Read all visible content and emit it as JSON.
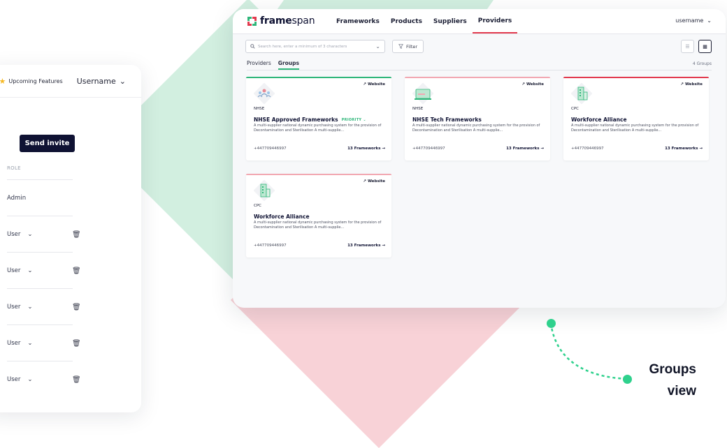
{
  "back_panel": {
    "upcoming_label": "Upcoming Features",
    "username": "Username",
    "invite_button": "Send invite",
    "role_header": "ROLE",
    "rows": [
      {
        "role": "Admin",
        "has_select": false
      },
      {
        "role": "User",
        "has_select": true
      },
      {
        "role": "User",
        "has_select": true
      },
      {
        "role": "User",
        "has_select": true
      },
      {
        "role": "User",
        "has_select": true
      },
      {
        "role": "User",
        "has_select": true
      }
    ]
  },
  "nav": {
    "logo_prefix": "frame",
    "logo_suffix": "span",
    "items": [
      "Frameworks",
      "Products",
      "Suppliers",
      "Providers"
    ],
    "active": "Providers",
    "username": "username"
  },
  "toolbar": {
    "search_placeholder": "Search here, enter a minimum of 3 characters",
    "filter_label": "Filter"
  },
  "subtabs": {
    "items": [
      "Providers",
      "Groups"
    ],
    "active": "Groups",
    "count": "4 Groups"
  },
  "colors": {
    "green": "#2fb67a",
    "red": "#e23a4e",
    "pink": "#f2a8b2",
    "navy": "#0f1233"
  },
  "cards": [
    {
      "abbr": "NHSE",
      "title": "NHSE Approved Frameworks",
      "priority": "PRIORITY",
      "icon": "people-group-icon",
      "accent": "green",
      "website": "Website",
      "description": "A multi-supplier national dynamic purchasing system for the provision of Decontamination and Sterilisation A multi-supplie...",
      "phone": "+447709446997",
      "frameworks": "13 Frameworks →"
    },
    {
      "abbr": "NHSE",
      "title": "NHSE Tech Frameworks",
      "priority": "",
      "icon": "laptop-icon",
      "accent": "pink",
      "website": "Website",
      "description": "A multi-supplier national dynamic purchasing system for the provision of Decontamination and Sterilisation A multi-supplie...",
      "phone": "+447709446997",
      "frameworks": "13 Frameworks →"
    },
    {
      "abbr": "CPC",
      "title": "Workforce Alliance",
      "priority": "",
      "icon": "building-icon",
      "accent": "red",
      "website": "Website",
      "description": "A multi-supplier national dynamic purchasing system for the provision of Decontamination and Sterilisation A multi-supplie...",
      "phone": "+447709446997",
      "frameworks": "13 Frameworks →"
    },
    {
      "abbr": "CPC",
      "title": "Workforce Alliance",
      "priority": "",
      "icon": "building-icon",
      "accent": "pink",
      "website": "Website",
      "description": "A multi-supplier national dynamic purchasing system for the provision of Decontamination and Sterilisation A multi-supplie...",
      "phone": "+447709446997",
      "frameworks": "13 Frameworks →"
    }
  ],
  "caption": {
    "line1": "Groups",
    "line2": "view"
  }
}
